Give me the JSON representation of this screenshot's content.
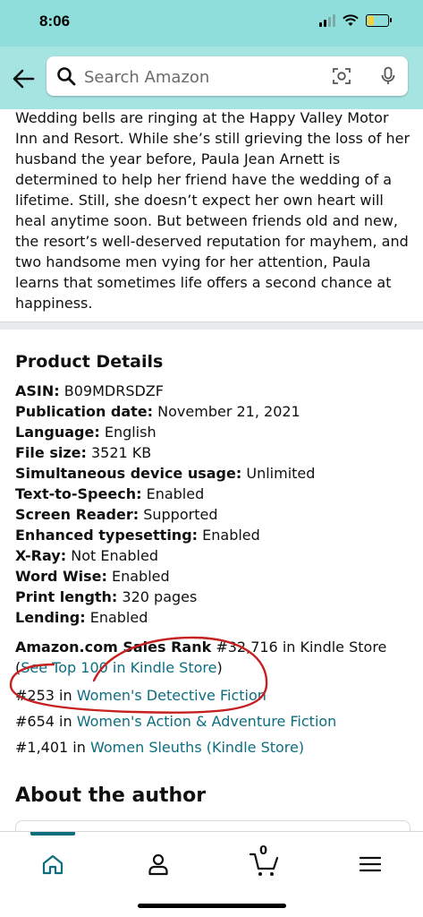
{
  "status": {
    "time": "8:06"
  },
  "search": {
    "placeholder": "Search Amazon"
  },
  "description": "Wedding bells are ringing at the Happy Valley Motor Inn and Resort. While she’s still grieving the loss of her husband the year before, Paula Jean Arnett is determined to help her friend have the wedding of a lifetime. Still, she doesn’t expect her own heart will heal anytime soon. But between friends old and new, the resort’s well-deserved reputation for mayhem, and two handsome men vying for her attention, Paula learns that sometimes life offers a second chance at happiness.",
  "product_details": {
    "title": "Product Details",
    "rows": [
      {
        "label": "ASIN:",
        "value": "B09MDRSDZF"
      },
      {
        "label": "Publication date:",
        "value": "November 21, 2021"
      },
      {
        "label": "Language:",
        "value": "English"
      },
      {
        "label": "File size:",
        "value": "3521 KB"
      },
      {
        "label": "Simultaneous device usage:",
        "value": "Unlimited"
      },
      {
        "label": "Text-to-Speech:",
        "value": "Enabled"
      },
      {
        "label": "Screen Reader:",
        "value": "Supported"
      },
      {
        "label": "Enhanced typesetting:",
        "value": "Enabled"
      },
      {
        "label": "X-Ray:",
        "value": "Not Enabled"
      },
      {
        "label": "Word Wise:",
        "value": "Enabled"
      },
      {
        "label": "Print length:",
        "value": "320 pages"
      },
      {
        "label": "Lending:",
        "value": "Enabled"
      }
    ]
  },
  "sales_rank": {
    "label": "Amazon.com Sales Rank",
    "main_text": "#32,716 in Kindle Store (",
    "see_top_link": "See Top 100 in Kindle Store",
    "close_paren": ")",
    "categories": [
      {
        "rank": "#253 in",
        "name": "Women's Detective Fiction"
      },
      {
        "rank": "#654 in",
        "name": "Women's Action & Adventure Fiction"
      },
      {
        "rank": "#1,401 in",
        "name": "Women Sleuths (Kindle Store)"
      }
    ]
  },
  "about_author": {
    "title": "About the author"
  },
  "bottom_nav": {
    "cart_count": "0"
  }
}
